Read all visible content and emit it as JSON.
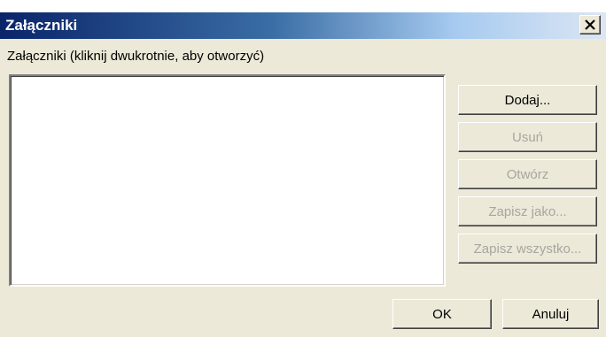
{
  "window": {
    "title": "Załączniki",
    "close_symbol": "✕"
  },
  "list_label": "Załączniki (kliknij dwukrotnie, aby otworzyć)",
  "attachments": [],
  "buttons": {
    "add": "Dodaj...",
    "remove": "Usuń",
    "open": "Otwórz",
    "save_as": "Zapisz jako...",
    "save_all": "Zapisz wszystko...",
    "ok": "OK",
    "cancel": "Anuluj"
  },
  "colors": {
    "dialog_bg": "#ece9d8",
    "title_start": "#0a246a",
    "disabled_text": "#a7a6a0"
  }
}
